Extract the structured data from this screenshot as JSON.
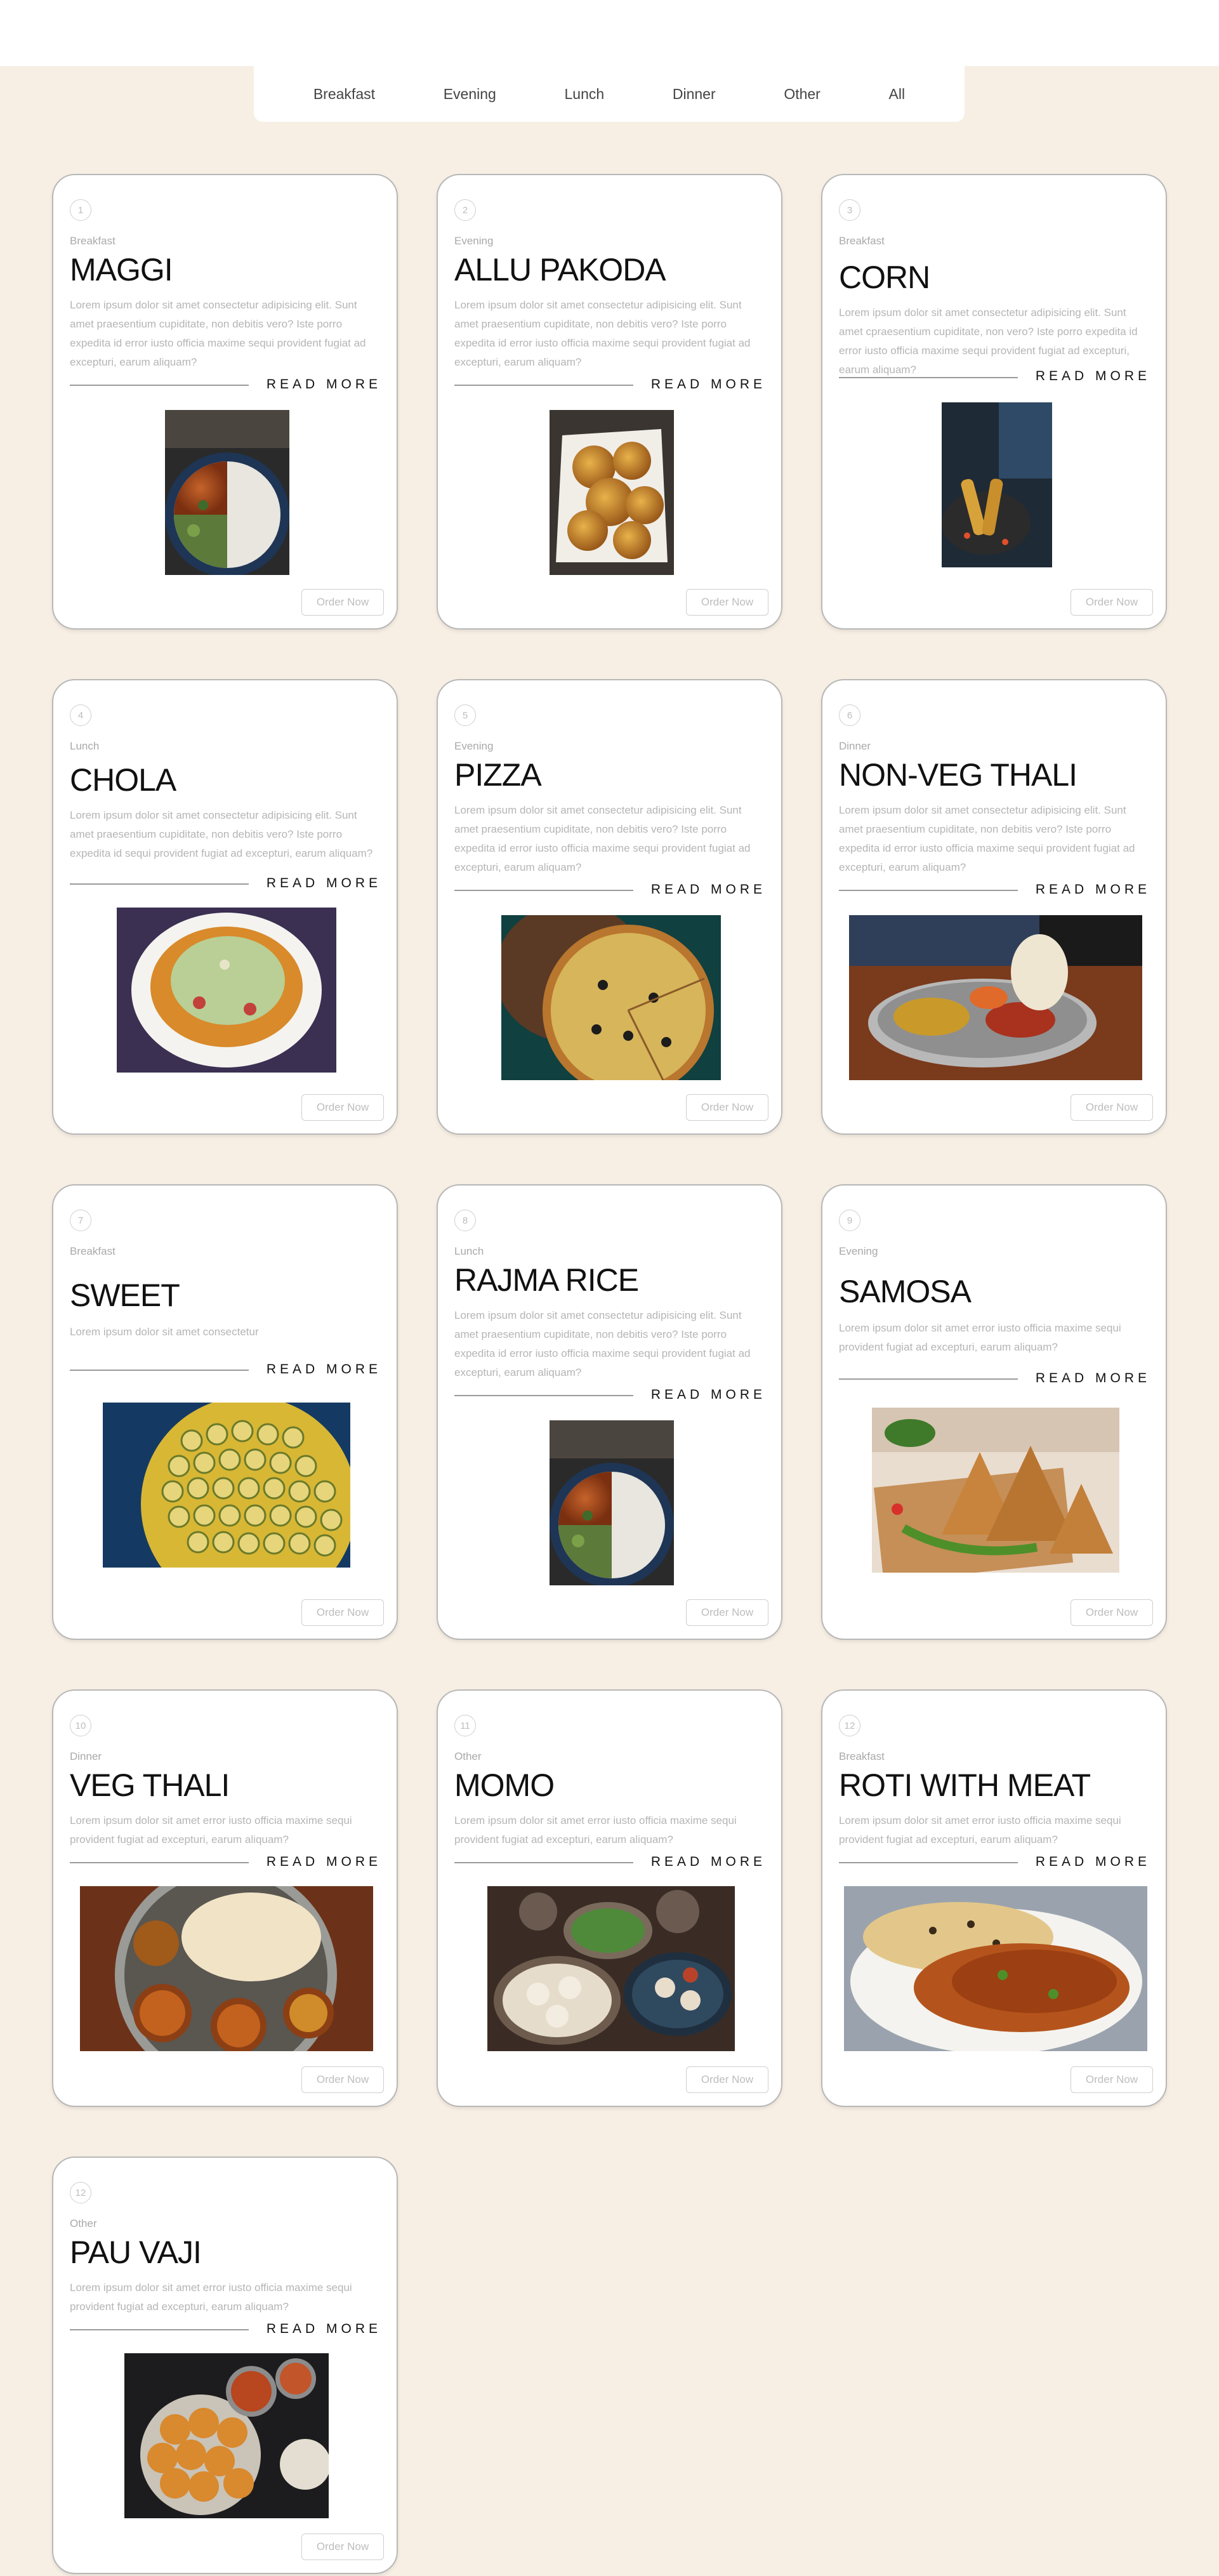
{
  "filters": [
    "Breakfast",
    "Evening",
    "Lunch",
    "Dinner",
    "Other",
    "All"
  ],
  "order_label": "Order Now",
  "read_more_label": "READ MORE",
  "items": [
    {
      "num": "1",
      "category": "Breakfast",
      "title": "MAGGI",
      "desc": "Lorem ipsum dolor sit amet consectetur adipisicing elit. Sunt amet praesentium cupiditate, non debitis vero? Iste porro expedita id error iusto officia maxime sequi provident fugiat ad excepturi, earum aliquam?",
      "image": "noodle-curry-bowl"
    },
    {
      "num": "2",
      "category": "Evening",
      "title": "ALLU PAKODA",
      "desc": "Lorem ipsum dolor sit amet consectetur adipisicing elit. Sunt amet praesentium cupiditate, non debitis vero? Iste porro expedita id error iusto officia maxime sequi provident fugiat ad excepturi, earum aliquam?",
      "image": "fried-pakoda-basket"
    },
    {
      "num": "3",
      "category": "Breakfast",
      "title": "CORN",
      "desc": "Lorem ipsum dolor sit amet consectetur adipisicing elit. Sunt amet cpraesentium cupiditate, non vero? Iste porro expedita id error iusto officia maxime sequi provident fugiat ad excepturi, earum aliquam?",
      "image": "roasted-corn-grill"
    },
    {
      "num": "4",
      "category": "Lunch",
      "title": "CHOLA",
      "desc": "Lorem ipsum dolor sit amet consectetur adipisicing elit. Sunt amet praesentium cupiditate, non debitis vero? Iste porro expedita id sequi provident fugiat ad excepturi, earum aliquam?",
      "image": "chola-chaat-plate"
    },
    {
      "num": "5",
      "category": "Evening",
      "title": "PIZZA",
      "desc": "Lorem ipsum dolor sit amet consectetur adipisicing elit. Sunt amet praesentium cupiditate, non debitis vero? Iste porro expedita id error iusto officia maxime sequi provident fugiat ad excepturi, earum aliquam?",
      "image": "pizza-board"
    },
    {
      "num": "6",
      "category": "Dinner",
      "title": "NON-VEG THALI",
      "desc": "Lorem ipsum dolor sit amet consectetur adipisicing elit. Sunt amet praesentium cupiditate, non debitis vero? Iste porro expedita id error iusto officia maxime sequi provident fugiat ad excepturi, earum aliquam?",
      "image": "non-veg-thali-plate"
    },
    {
      "num": "7",
      "category": "Breakfast",
      "title": "SWEET",
      "desc": "Lorem ipsum dolor sit amet consectetur",
      "image": "sweets-platter"
    },
    {
      "num": "8",
      "category": "Lunch",
      "title": "RAJMA RICE",
      "desc": "Lorem ipsum dolor sit amet consectetur adipisicing elit. Sunt amet praesentium cupiditate, non debitis vero? Iste porro expedita id error iusto officia maxime sequi provident fugiat ad excepturi, earum aliquam?",
      "image": "rajma-rice-bowl"
    },
    {
      "num": "9",
      "category": "Evening",
      "title": "SAMOSA",
      "desc": "Lorem ipsum dolor sit amet error iusto officia maxime sequi provident fugiat ad excepturi, earum aliquam?",
      "image": "samosa-plate"
    },
    {
      "num": "10",
      "category": "Dinner",
      "title": "VEG THALI",
      "desc": "Lorem ipsum dolor sit amet error iusto officia maxime sequi provident fugiat ad excepturi, earum aliquam?",
      "image": "veg-thali-plate"
    },
    {
      "num": "11",
      "category": "Other",
      "title": "MOMO",
      "desc": "Lorem ipsum dolor sit amet error iusto officia maxime sequi provident fugiat ad excepturi, earum aliquam?",
      "image": "momo-bowls"
    },
    {
      "num": "12",
      "category": "Breakfast",
      "title": "ROTI WITH MEAT",
      "desc": "Lorem ipsum dolor sit amet error iusto officia maxime sequi provident fugiat ad excepturi, earum aliquam?",
      "image": "roti-meat-curry"
    },
    {
      "num": "12",
      "category": "Other",
      "title": "PAU VAJI",
      "desc": "Lorem ipsum dolor sit amet error iusto officia maxime sequi provident fugiat ad excepturi, earum aliquam?",
      "image": "pav-bhaji-platter"
    }
  ]
}
